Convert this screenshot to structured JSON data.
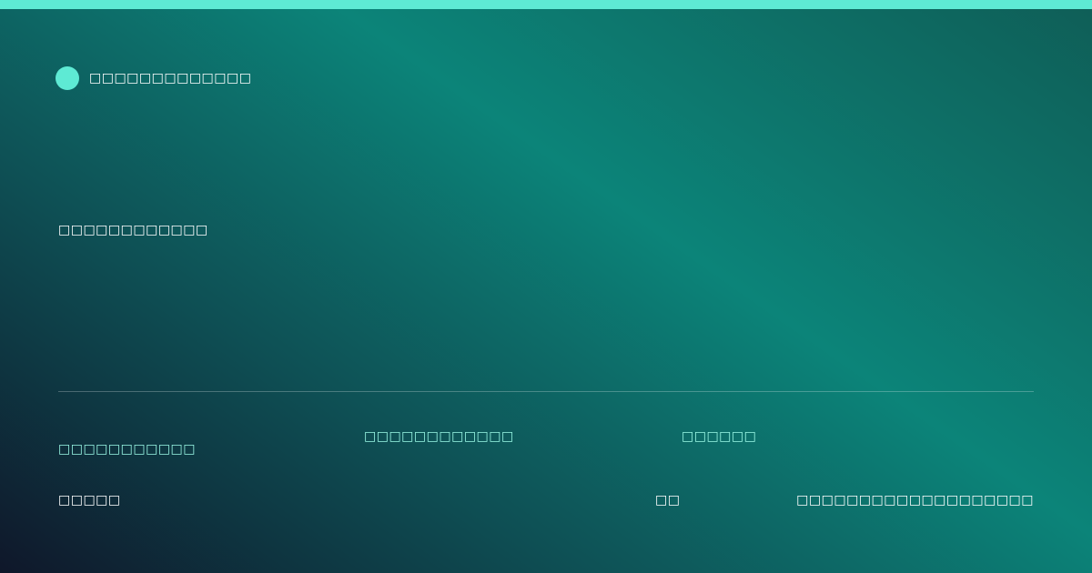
{
  "brand": {
    "name": "□□□□□□□□□□□□□",
    "accent_color": "#5eead4"
  },
  "hero": {
    "headline": "□□□□□□□□□□□□"
  },
  "meta": {
    "item_1": "□□□□□□□□□□□",
    "item_2": "□□□□□□□□□□□□",
    "item_3": "□□□□□□",
    "color": "#99f6e4"
  },
  "footer": {
    "left": "□□□□□",
    "middle": "□□",
    "right": "□□□□□□□□□□□□□□□□□□□"
  }
}
